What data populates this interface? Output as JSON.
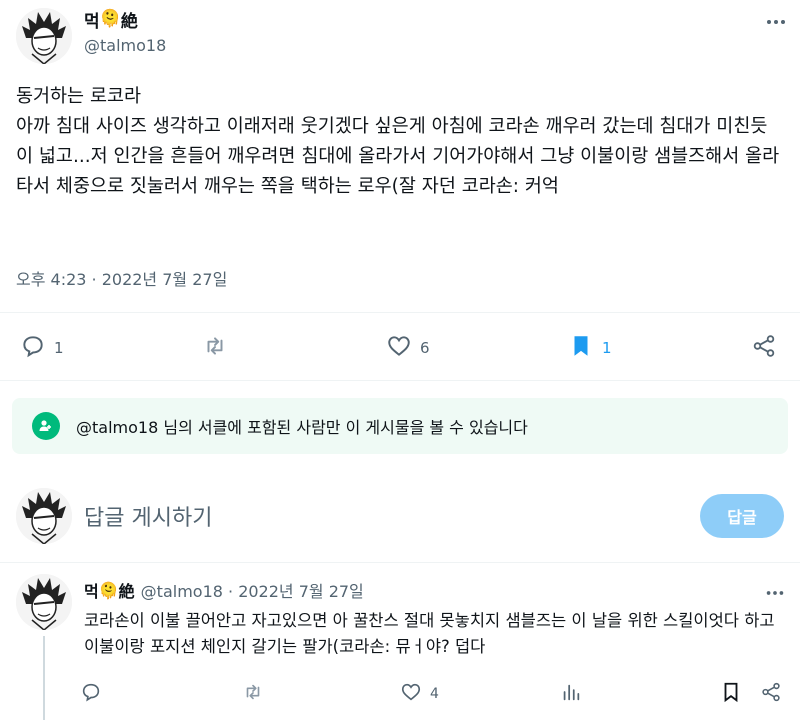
{
  "author": {
    "name_part1": "먹",
    "emoji": "🫠",
    "name_part2": "絶",
    "handle": "@talmo18"
  },
  "tweet": {
    "text": "동거하는 로코라\n아까 침대 사이즈 생각하고 이래저래 웃기겠다 싶은게 아침에 코라손 깨우러 갔는데 침대가 미친듯이 넓고...저 인간을 흔들어 깨우려면 침대에 올라가서 기어가야해서 그냥 이불이랑 샘블즈해서 올라타서 체중으로 짓눌러서 깨우는 쪽을 택하는 로우(잘 자던 코라손: 커억",
    "timestamp": "오후 4:23 · 2022년 7월 27일"
  },
  "actions": {
    "reply_count": "1",
    "like_count": "6",
    "bookmark_count": "1"
  },
  "circle_notice": {
    "text": "@talmo18 님의 서클에 포함된 사람만 이 게시물을 볼 수 있습니다"
  },
  "compose": {
    "placeholder": "답글 게시하기",
    "button_label": "답글"
  },
  "reply": {
    "name_part1": "먹",
    "emoji": "🫠",
    "name_part2": "絶",
    "handle_date": "@talmo18 · 2022년 7월 27일",
    "text": "코라손이 이불 끌어안고 자고있으면 아 꿀찬스 절대 못놓치지 샘블즈는 이 날을 위한 스킬이엇다 하고 이불이랑 포지션 체인지 갈기는 팔가(코라손: 뮤ㅓ야? 덥다",
    "like_count": "4"
  },
  "colors": {
    "accent": "#1d9bf0",
    "muted": "#536471",
    "circle_green": "#00ba7c",
    "circle_bg": "#effaf5",
    "reply_button_disabled": "#8ecdf8"
  },
  "icons": [
    "reply-icon",
    "retweet-icon",
    "like-icon",
    "bookmark-icon",
    "share-icon",
    "views-icon",
    "circle-people-icon",
    "more-icon"
  ]
}
